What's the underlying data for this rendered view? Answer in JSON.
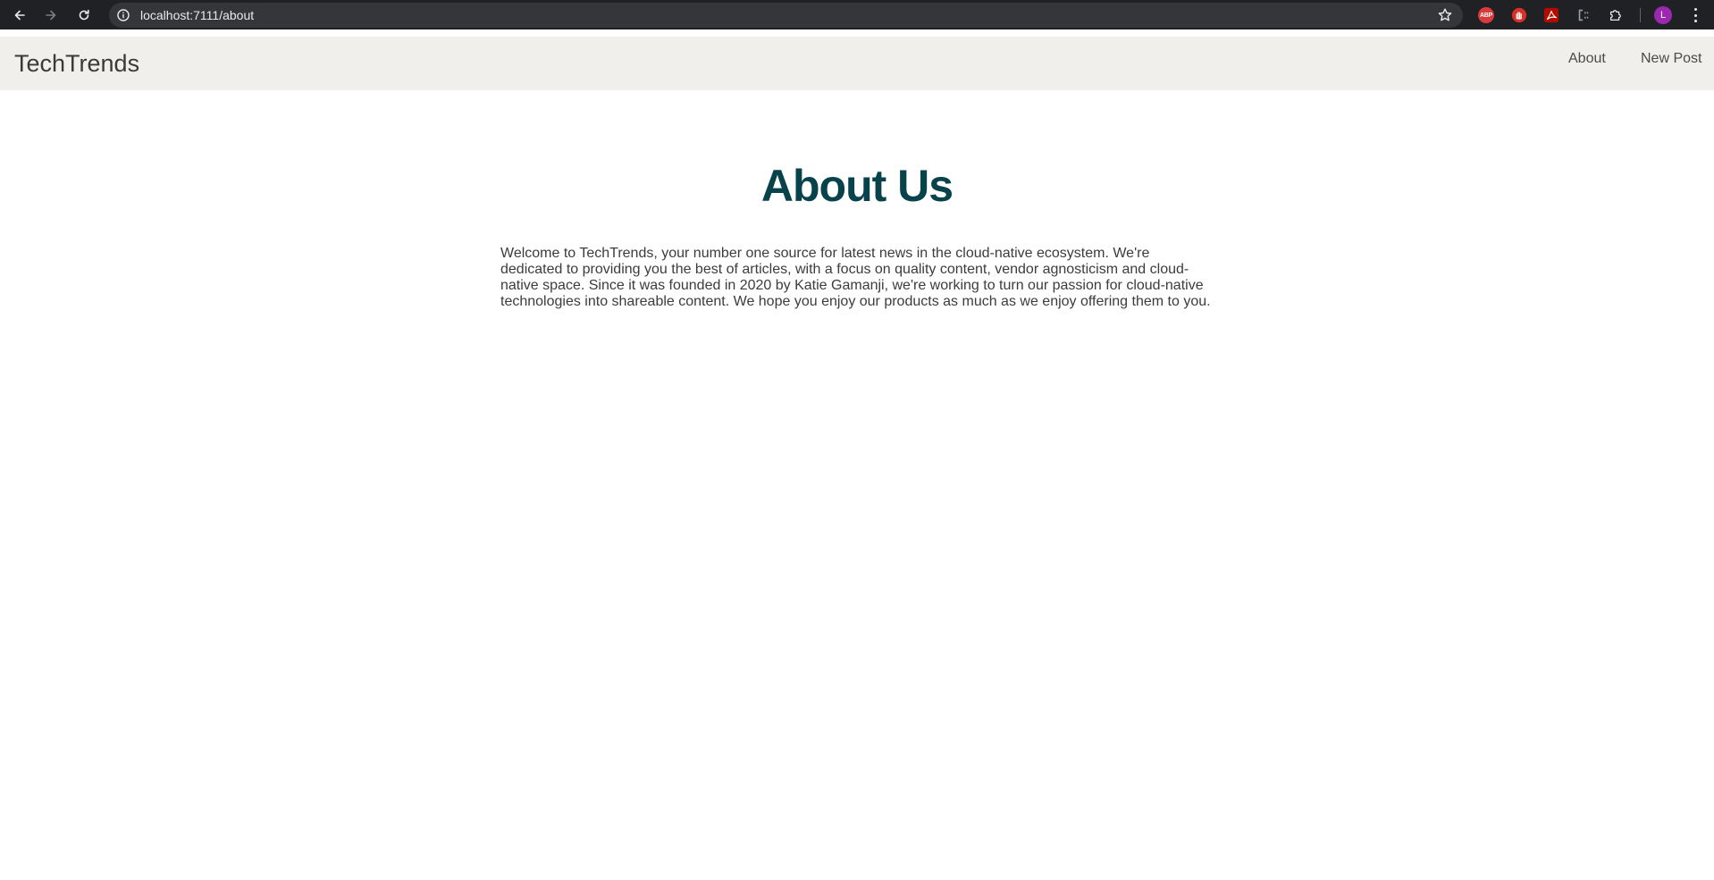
{
  "browser": {
    "url": "localhost:7111/about",
    "extensions": {
      "abp_label": "ABP",
      "avatar_initial": "L"
    },
    "colors": {
      "chrome_bg": "#202124",
      "omnibox_bg": "#35363a"
    }
  },
  "navbar": {
    "brand": "TechTrends",
    "links": [
      {
        "label": "About"
      },
      {
        "label": "New Post"
      }
    ],
    "colors": {
      "background": "#f0efeb"
    }
  },
  "main": {
    "title": "About Us",
    "paragraph": "Welcome to TechTrends, your number one source for latest news in the cloud-native ecosystem. We're dedicated to providing you the best of articles, with a focus on quality content, vendor agnosticism and cloud-native space. Since it was founded in 2020 by Katie Gamanji, we're working to turn our passion for cloud-native technologies into shareable content. We hope you enjoy our products as much as we enjoy offering them to you.",
    "colors": {
      "title": "#08424a",
      "text": "#3c3c3c"
    }
  }
}
